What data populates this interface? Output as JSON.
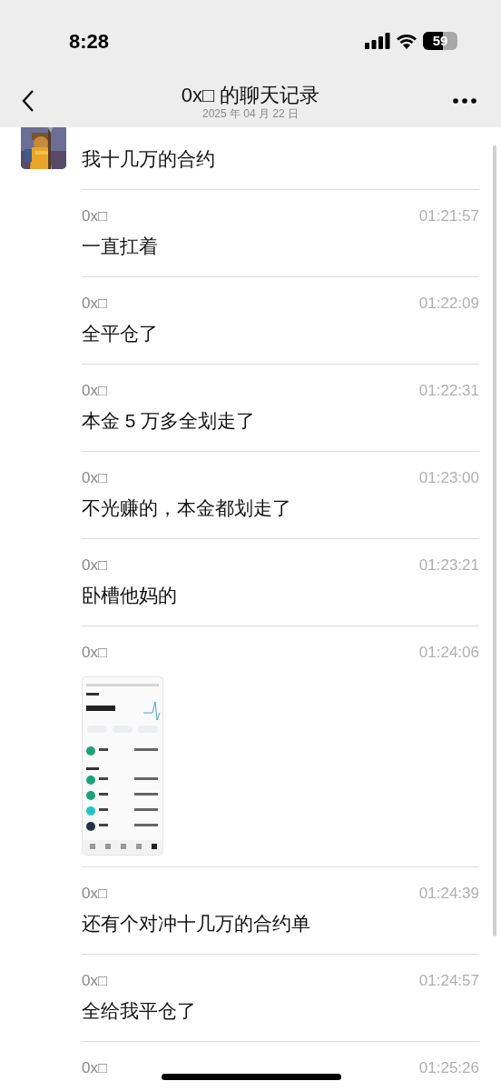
{
  "status_bar": {
    "time": "8:28",
    "battery": "59"
  },
  "header": {
    "title": "0x□ 的聊天记录",
    "date": "2025 年 04 月 22 日"
  },
  "messages": [
    {
      "kind": "text",
      "avatar": true,
      "text": "我十几万的合约"
    },
    {
      "kind": "text",
      "avatar": false,
      "sender": "0x□",
      "time": "01:21:57",
      "text": "一直扛着"
    },
    {
      "kind": "text",
      "avatar": false,
      "sender": "0x□",
      "time": "01:22:09",
      "text": "全平仓了"
    },
    {
      "kind": "text",
      "avatar": false,
      "sender": "0x□",
      "time": "01:22:31",
      "text": "本金 5 万多全划走了"
    },
    {
      "kind": "text",
      "avatar": false,
      "sender": "0x□",
      "time": "01:23:00",
      "text": "不光赚的，本金都划走了"
    },
    {
      "kind": "text",
      "avatar": false,
      "sender": "0x□",
      "time": "01:23:21",
      "text": "卧槽他妈的"
    },
    {
      "avatar": false,
      "sender": "0x□",
      "time": "01:24:06"
    },
    {
      "kind": "text",
      "avatar": false,
      "sender": "0x□",
      "time": "01:24:39",
      "text": "还有个对冲十几万的合约单"
    },
    {
      "kind": "text",
      "avatar": false,
      "sender": "0x□",
      "time": "01:24:57",
      "text": "全给我平仓了"
    },
    {
      "kind": "text",
      "avatar": false,
      "sender": "0x□",
      "time": "01:25:26"
    }
  ]
}
